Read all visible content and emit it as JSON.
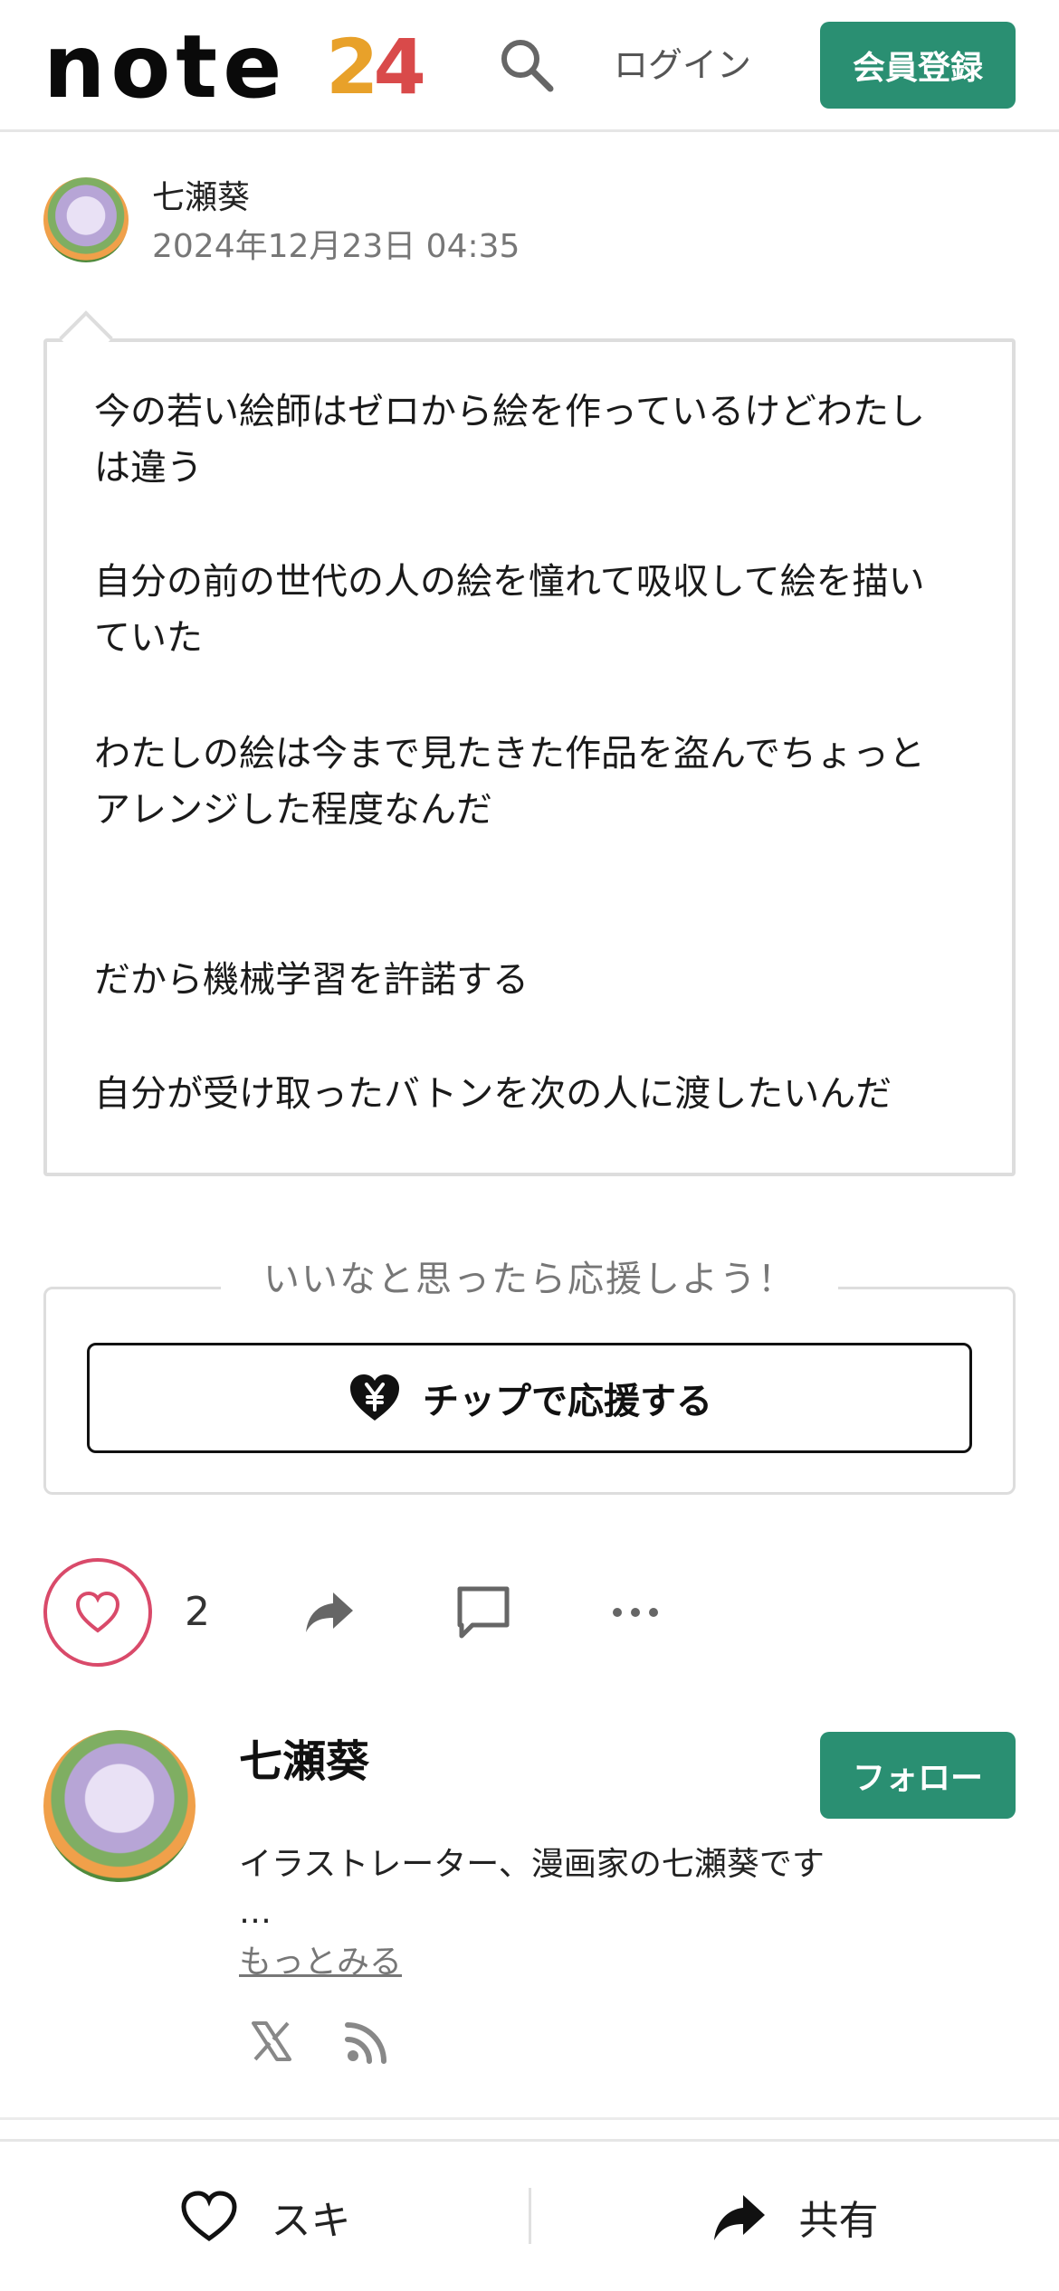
{
  "header": {
    "logo_text": "note",
    "logo_badge_left": "2",
    "logo_badge_right": "4",
    "login_label": "ログイン",
    "signup_label": "会員登録"
  },
  "meta": {
    "author_name": "七瀬葵",
    "date": "2024年12月23日 04:35"
  },
  "post": {
    "lines": [
      "今の若い絵師はゼロから絵を作っているけどわたし",
      "は違う",
      "自分の前の世代の人の絵を憧れて吸収して絵を描い",
      "ていた",
      "わたしの絵は今まで見たきた作品を盗んでちょっと",
      "アレンジした程度なんだ",
      "だから機械学習を許諾する",
      "自分が受け取ったバトンを次の人に渡したいんだ"
    ]
  },
  "support": {
    "caption": "いいなと思ったら応援しよう！",
    "tip_label": "チップで応援する"
  },
  "actions": {
    "like_count": "2"
  },
  "profile": {
    "name": "七瀬葵",
    "follow_label": "フォロー",
    "bio": "イラストレーター、漫画家の七瀬葵です",
    "ellipsis": "…",
    "more_label": "もっとみる"
  },
  "bottom_bar": {
    "like_label": "スキ",
    "share_label": "共有"
  },
  "colors": {
    "brand_green": "#2a8f72",
    "like_pink": "#d94a6a",
    "border_gray": "#dddddd"
  }
}
